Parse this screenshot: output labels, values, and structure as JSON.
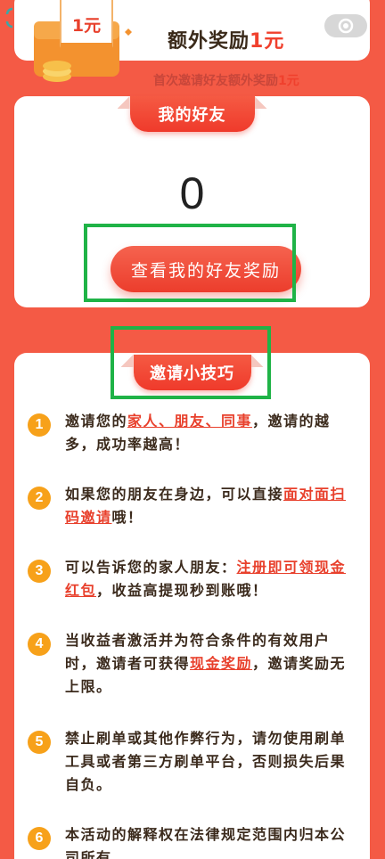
{
  "bonus": {
    "gift_amount": "1元",
    "title_prefix": "额外奖励",
    "title_amount": "1元",
    "subtitle_prefix": "首次邀请好友额外奖励",
    "subtitle_amount": "1元"
  },
  "friends": {
    "header": "我的好友",
    "count": "0",
    "button_label": "查看我的好友奖励"
  },
  "tips": {
    "header": "邀请小技巧",
    "items": [
      {
        "num": "1",
        "parts": [
          "邀请您的",
          "家人、朋友、同事",
          "，邀请的越多，成功率越高！"
        ]
      },
      {
        "num": "2",
        "parts": [
          "如果您的朋友在身边，可以直接",
          "面对面扫码邀请",
          "哦！"
        ]
      },
      {
        "num": "3",
        "parts": [
          "可以告诉您的家人朋友：",
          "注册即可领现金红包",
          "，收益高提现秒到账哦！"
        ]
      },
      {
        "num": "4",
        "parts": [
          "当收益者激活并为符合条件的有效用户时，邀请者可获得",
          "现金奖励",
          "，邀请奖励无上限。"
        ]
      },
      {
        "num": "5",
        "text": "禁止刷单或其他作弊行为，请勿使用刷单工具或者第三方刷单平台，否则损失后果自负。"
      },
      {
        "num": "6",
        "text": "本活动的解释权在法律规定范围内归本公司所有"
      }
    ]
  },
  "colors": {
    "background": "#f45a45",
    "accent": "#ef3a2b",
    "highlight": "#e8402c",
    "number_badge": "#f7a11a",
    "annotation_box": "#1fb347"
  },
  "icons": {
    "gift": "red-envelope-gift-icon",
    "eye": "eye-icon",
    "refresh": "refresh-icon"
  }
}
